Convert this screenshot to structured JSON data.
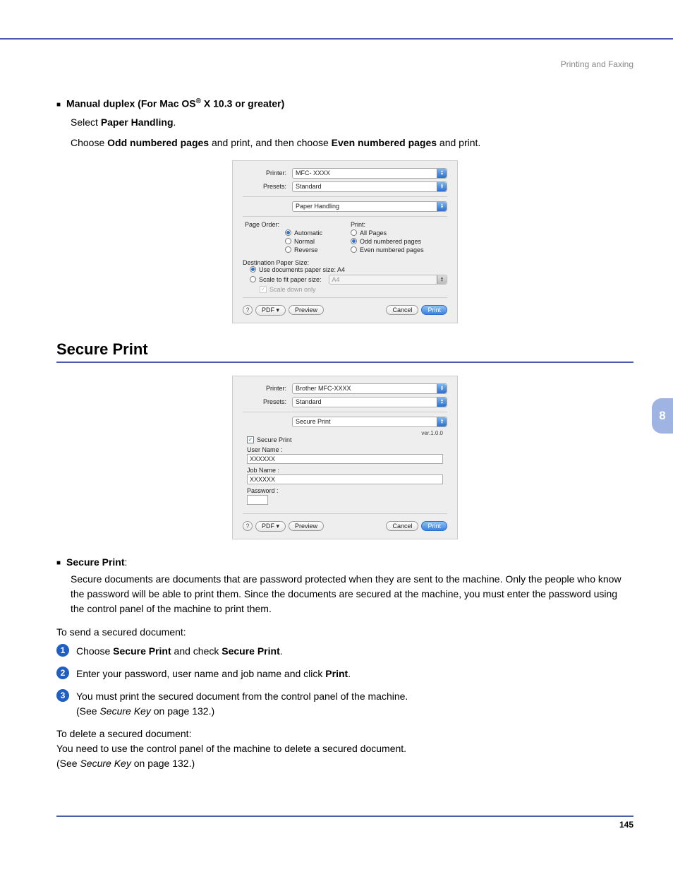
{
  "header": {
    "breadcrumb": "Printing and Faxing"
  },
  "section1": {
    "title_pre": "Manual duplex (For Mac OS",
    "title_sup": "®",
    "title_post": " X 10.3 or greater)",
    "line1_pre": "Select ",
    "line1_bold": "Paper Handling",
    "line1_post": ".",
    "line2_pre": "Choose ",
    "line2_bold1": "Odd numbered pages",
    "line2_mid": " and print, and then choose ",
    "line2_bold2": "Even numbered pages",
    "line2_post": " and print."
  },
  "dialog1": {
    "printer_label": "Printer:",
    "printer_value": "MFC- XXXX",
    "presets_label": "Presets:",
    "presets_value": "Standard",
    "panel_value": "Paper Handling",
    "page_order_label": "Page Order:",
    "po_auto": "Automatic",
    "po_normal": "Normal",
    "po_reverse": "Reverse",
    "print_label": "Print:",
    "pr_all": "All Pages",
    "pr_odd": "Odd numbered pages",
    "pr_even": "Even numbered pages",
    "dest_label": "Destination Paper Size:",
    "use_doc": "Use documents paper size: A4",
    "scale_fit": "Scale to fit paper size:",
    "scale_sel": "A4",
    "scale_down": "Scale down only",
    "help": "?",
    "pdf": "PDF ▾",
    "preview": "Preview",
    "cancel": "Cancel",
    "print": "Print"
  },
  "section2": {
    "title": "Secure Print"
  },
  "dialog2": {
    "printer_label": "Printer:",
    "printer_value": "Brother MFC-XXXX",
    "presets_label": "Presets:",
    "presets_value": "Standard",
    "panel_value": "Secure Print",
    "version": "ver.1.0.0",
    "chk_label": "Secure Print",
    "user_label": "User Name :",
    "user_value": "XXXXXX",
    "job_label": "Job Name :",
    "job_value": "XXXXXX",
    "pw_label": "Password :",
    "help": "?",
    "pdf": "PDF ▾",
    "preview": "Preview",
    "cancel": "Cancel",
    "print": "Print"
  },
  "secure_desc": {
    "title": "Secure Print",
    "colon": ":",
    "body": "Secure documents are documents that are password protected when they are sent to the machine. Only the people who know the password will be able to print them. Since the documents are secured at the machine, you must enter the password using the control panel of the machine to print them."
  },
  "send_intro": "To send a secured document:",
  "steps": {
    "s1_pre": "Choose ",
    "s1_b1": "Secure Print",
    "s1_mid": " and check ",
    "s1_b2": "Secure Print",
    "s1_post": ".",
    "s2_pre": "Enter your password, user name and job name and click ",
    "s2_b": "Print",
    "s2_post": ".",
    "s3_l1": "You must print the secured document from the control panel of the machine.",
    "s3_l2_pre": "(See ",
    "s3_l2_i": "Secure Key",
    "s3_l2_post": " on page 132.)"
  },
  "delete": {
    "intro": "To delete a secured document:",
    "line": "You need to use the control panel of the machine to delete a secured document.",
    "ref_pre": "(See ",
    "ref_i": "Secure Key",
    "ref_post": " on page 132.)"
  },
  "side_tab": "8",
  "page_number": "145"
}
